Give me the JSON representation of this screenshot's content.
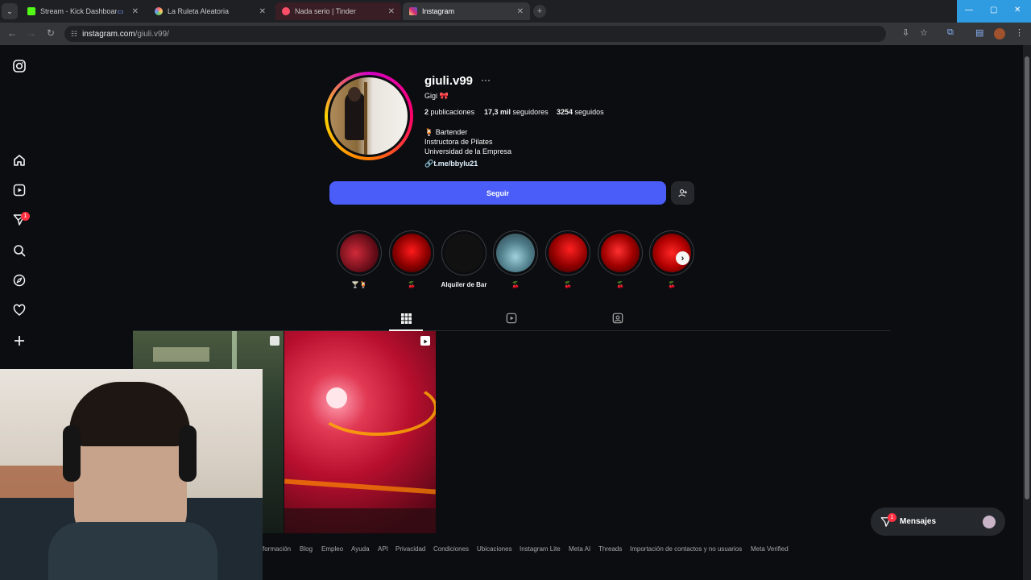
{
  "browser": {
    "tabs": [
      {
        "label": "Stream - Kick Dashboard",
        "color": "#53fc18"
      },
      {
        "label": "La Ruleta Aleatoria",
        "color": "#e0e0e0"
      },
      {
        "label": "Nada serio | Tinder",
        "color": "#fd5068"
      },
      {
        "label": "Instagram",
        "color": "#e1306c"
      }
    ],
    "url_host": "instagram.com",
    "url_path": "/giuli.v99/"
  },
  "profile": {
    "username": "giuli.v99",
    "full_name": "Gigi 🎀",
    "stats": {
      "posts_count": "2",
      "posts_label": "publicaciones",
      "followers_count": "17,3 mil",
      "followers_label": "seguidores",
      "following_count": "3254",
      "following_label": "seguidos"
    },
    "bio": [
      "🍹 Bartender",
      "Instructora de Pilates",
      "Universidad de la Empresa"
    ],
    "link": "t.me/bbylu21",
    "follow_label": "Seguir"
  },
  "highlights": [
    {
      "label": "🍸🍹",
      "color": "#7a0f1a"
    },
    {
      "label": "🍒",
      "color": "#9a0000"
    },
    {
      "label": "Alquiler de Bar",
      "color": "#111111"
    },
    {
      "label": "🍒",
      "color": "#4f7d8a"
    },
    {
      "label": "🍒",
      "color": "#a00000"
    },
    {
      "label": "🍒",
      "color": "#b00000"
    },
    {
      "label": "🍒",
      "color": "#b80000"
    }
  ],
  "footer": [
    "Información",
    "Blog",
    "Empleo",
    "Ayuda",
    "API",
    "Privacidad",
    "Condiciones",
    "Ubicaciones",
    "Instagram Lite",
    "Meta AI",
    "Threads",
    "Importación de contactos y no usuarios",
    "Meta Verified"
  ],
  "footer_visible_first": "formación",
  "messages": {
    "label": "Mensajes",
    "badge": "1"
  },
  "notifications_badge": "1"
}
